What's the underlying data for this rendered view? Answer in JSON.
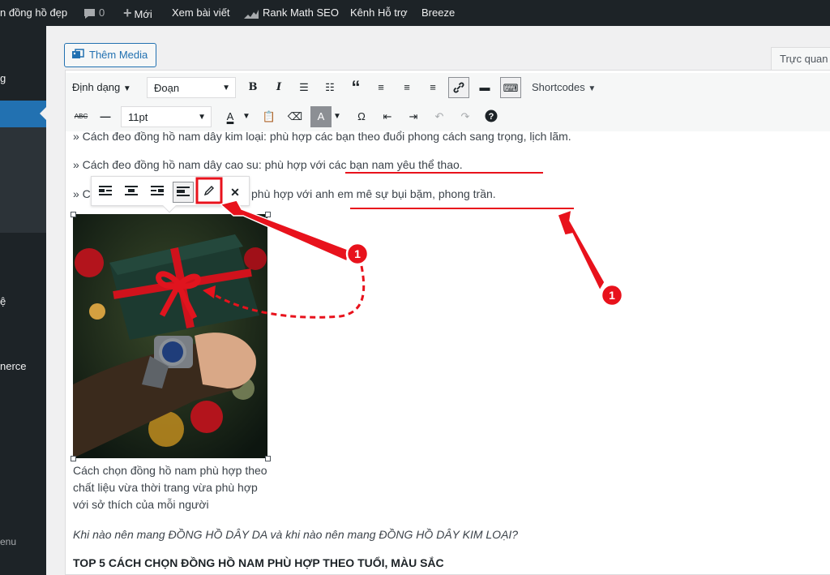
{
  "admin_bar": {
    "site_name": "n đồng hồ đẹp",
    "comments_count": "0",
    "new_label": "Mới",
    "view_post": "Xem bài viết",
    "rank_math": "Rank Math SEO",
    "support": "Kênh Hỗ trợ",
    "breeze": "Breeze"
  },
  "sidebar": {
    "items": [
      {
        "label": "g"
      },
      {
        "label": "ệ"
      },
      {
        "label": "nerce"
      },
      {
        "label": "enu"
      }
    ]
  },
  "editor": {
    "add_media_label": "Thêm Media",
    "tab_visual": "Trực quan",
    "format_select": "Định dạng",
    "paragraph_select": "Đoạn",
    "shortcodes_label": "Shortcodes",
    "font_size": "11pt"
  },
  "content": {
    "line1": "» Cách đeo đồng hồ nam dây kim loại: phù hợp các bạn theo đuổi phong cách sang trọng, lịch lãm.",
    "line2": "» Cách đeo đồng hồ nam dây cao su: phù hợp với các bạn nam yêu thể thao.",
    "line3_prefix": "» C",
    "line3_rest": "phù hợp với anh em mê sự bụi bặm, phong trần.",
    "caption": "Cách chọn đồng hồ nam phù hợp theo chất liệu vừa thời trang vừa phù hợp với sở thích của mỗi người",
    "italic_line": "Khi nào nên mang ĐỒNG HỒ DÂY DA và khi nào nên mang ĐỒNG HỒ DÂY KIM LOẠI?",
    "heading": "TOP 5 CÁCH CHỌN ĐỒNG HỒ NAM PHÙ HỢP THEO TUỔI, MÀU SẮC"
  },
  "annotations": {
    "marker_left": "1",
    "marker_right": "1",
    "accent_color": "#e8121c"
  }
}
